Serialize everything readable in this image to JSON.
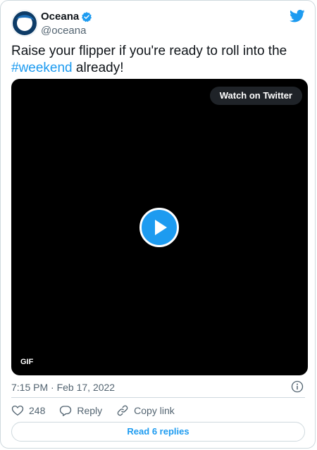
{
  "author": {
    "display_name": "Oceana",
    "handle": "@oceana",
    "verified": true,
    "avatar_icon": "oceana-logo-icon"
  },
  "tweet": {
    "text_before": "Raise your flipper if you're ready to roll into the ",
    "hashtag": "#weekend",
    "text_after": " already!"
  },
  "media": {
    "watch_label": "Watch on Twitter",
    "gif_label": "GIF"
  },
  "meta": {
    "timestamp": "7:15 PM · Feb 17, 2022"
  },
  "actions": {
    "like_count": "248",
    "reply_label": "Reply",
    "copy_label": "Copy link"
  },
  "replies_button": {
    "label": "Read 6 replies"
  },
  "colors": {
    "accent": "#1d9bf0",
    "text_primary": "#0f1419",
    "text_secondary": "#536471",
    "border": "#cfd9de",
    "media_bg": "#000000"
  },
  "icons": [
    "oceana-logo-icon",
    "verified-badge-icon",
    "twitter-bird-icon",
    "play-icon",
    "info-icon",
    "heart-icon",
    "reply-icon",
    "link-icon"
  ]
}
